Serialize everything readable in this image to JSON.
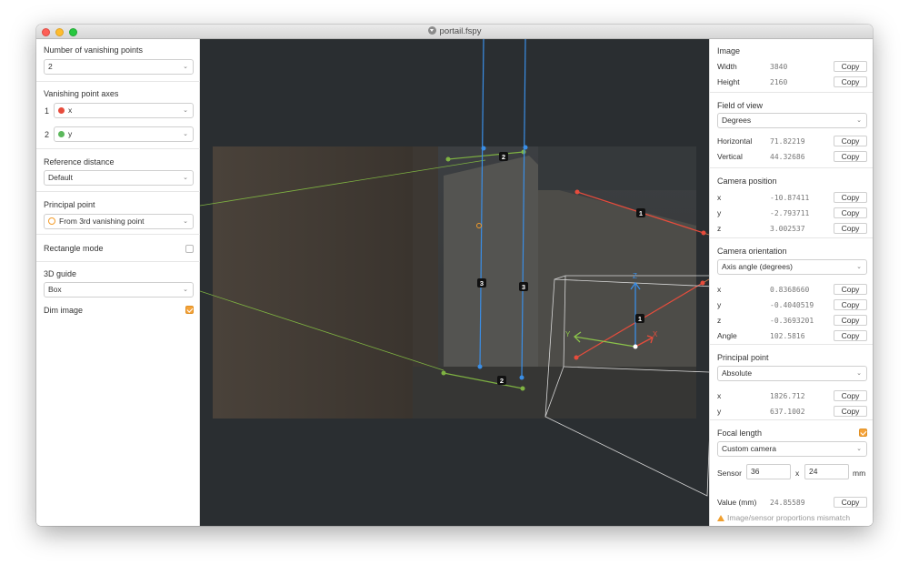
{
  "window": {
    "title": "portail.fspy"
  },
  "left": {
    "vanishing_points": {
      "label": "Number of vanishing points",
      "value": "2"
    },
    "axes": {
      "label": "Vanishing point axes",
      "items": [
        {
          "num": "1",
          "axis": "x",
          "color": "#e74c3c"
        },
        {
          "num": "2",
          "axis": "y",
          "color": "#5cb85c"
        }
      ]
    },
    "reference_distance": {
      "label": "Reference distance",
      "value": "Default"
    },
    "principal_point": {
      "label": "Principal point",
      "value": "From 3rd vanishing point"
    },
    "rectangle_mode": {
      "label": "Rectangle mode",
      "checked": false
    },
    "guide": {
      "label": "3D guide",
      "value": "Box"
    },
    "dim_image": {
      "label": "Dim image",
      "checked": true
    }
  },
  "canvas": {
    "labels": [
      "1",
      "1",
      "2",
      "2",
      "3",
      "3"
    ],
    "gizmo": {
      "x": "X",
      "y": "Y",
      "z": "Z"
    },
    "colors": {
      "x_axis": "#e74c3c",
      "y_axis": "#8bc34a",
      "z_axis": "#3a8ee6"
    }
  },
  "right": {
    "image": {
      "title": "Image",
      "rows": [
        {
          "key": "Width",
          "value": "3840",
          "copy": "Copy"
        },
        {
          "key": "Height",
          "value": "2160",
          "copy": "Copy"
        }
      ]
    },
    "fov": {
      "title": "Field of view",
      "unit": "Degrees",
      "rows": [
        {
          "key": "Horizontal",
          "value": "71.82219",
          "copy": "Copy"
        },
        {
          "key": "Vertical",
          "value": "44.32686",
          "copy": "Copy"
        }
      ]
    },
    "camera_position": {
      "title": "Camera position",
      "rows": [
        {
          "key": "x",
          "value": "-10.87411",
          "copy": "Copy"
        },
        {
          "key": "y",
          "value": "-2.793711",
          "copy": "Copy"
        },
        {
          "key": "z",
          "value": "3.002537",
          "copy": "Copy"
        }
      ]
    },
    "camera_orientation": {
      "title": "Camera orientation",
      "mode": "Axis angle (degrees)",
      "rows": [
        {
          "key": "x",
          "value": "0.8368660",
          "copy": "Copy"
        },
        {
          "key": "y",
          "value": "-0.4040519",
          "copy": "Copy"
        },
        {
          "key": "z",
          "value": "-0.3693201",
          "copy": "Copy"
        },
        {
          "key": "Angle",
          "value": "102.5816",
          "copy": "Copy"
        }
      ]
    },
    "principal_point": {
      "title": "Principal point",
      "mode": "Absolute",
      "rows": [
        {
          "key": "x",
          "value": "1826.712",
          "copy": "Copy"
        },
        {
          "key": "y",
          "value": "637.1002",
          "copy": "Copy"
        }
      ]
    },
    "focal_length": {
      "title": "Focal length",
      "checked": true,
      "camera": "Custom camera",
      "sensor_label": "Sensor",
      "sensor_w": "36",
      "sensor_x": "x",
      "sensor_h": "24",
      "sensor_unit": "mm",
      "value_label": "Value (mm)",
      "value": "24.85589",
      "copy": "Copy",
      "warning": "Image/sensor proportions mismatch"
    }
  }
}
